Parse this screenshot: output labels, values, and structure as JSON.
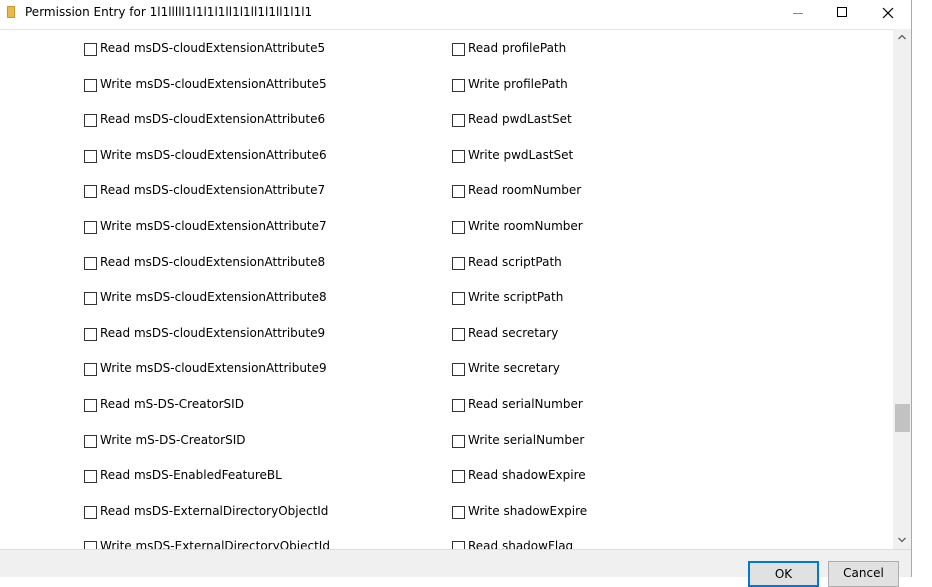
{
  "window": {
    "title": "Permission Entry for 1l1lllll1l1l1l1ll1l1ll1l1ll1l1l1"
  },
  "permissions": {
    "left": [
      "Read msDS-cloudExtensionAttribute5",
      "Write msDS-cloudExtensionAttribute5",
      "Read msDS-cloudExtensionAttribute6",
      "Write msDS-cloudExtensionAttribute6",
      "Read msDS-cloudExtensionAttribute7",
      "Write msDS-cloudExtensionAttribute7",
      "Read msDS-cloudExtensionAttribute8",
      "Write msDS-cloudExtensionAttribute8",
      "Read msDS-cloudExtensionAttribute9",
      "Write msDS-cloudExtensionAttribute9",
      "Read mS-DS-CreatorSID",
      "Write mS-DS-CreatorSID",
      "Read msDS-EnabledFeatureBL",
      "Read msDS-ExternalDirectoryObjectId",
      "Write msDS-ExternalDirectoryObjectId"
    ],
    "right": [
      "Read profilePath",
      "Write profilePath",
      "Read pwdLastSet",
      "Write pwdLastSet",
      "Read roomNumber",
      "Write roomNumber",
      "Read scriptPath",
      "Write scriptPath",
      "Read secretary",
      "Write secretary",
      "Read serialNumber",
      "Write serialNumber",
      "Read shadowExpire",
      "Write shadowExpire",
      "Read shadowFlag"
    ],
    "checked": false
  },
  "footer": {
    "ok_label": "OK",
    "cancel_label": "Cancel"
  },
  "colors": {
    "accent": "#0078d7"
  },
  "icons": {
    "title": "folder-icon",
    "minimize": "minimize-icon",
    "maximize": "maximize-icon",
    "close": "close-icon",
    "scroll_up": "chevron-up-icon",
    "scroll_down": "chevron-down-icon"
  }
}
